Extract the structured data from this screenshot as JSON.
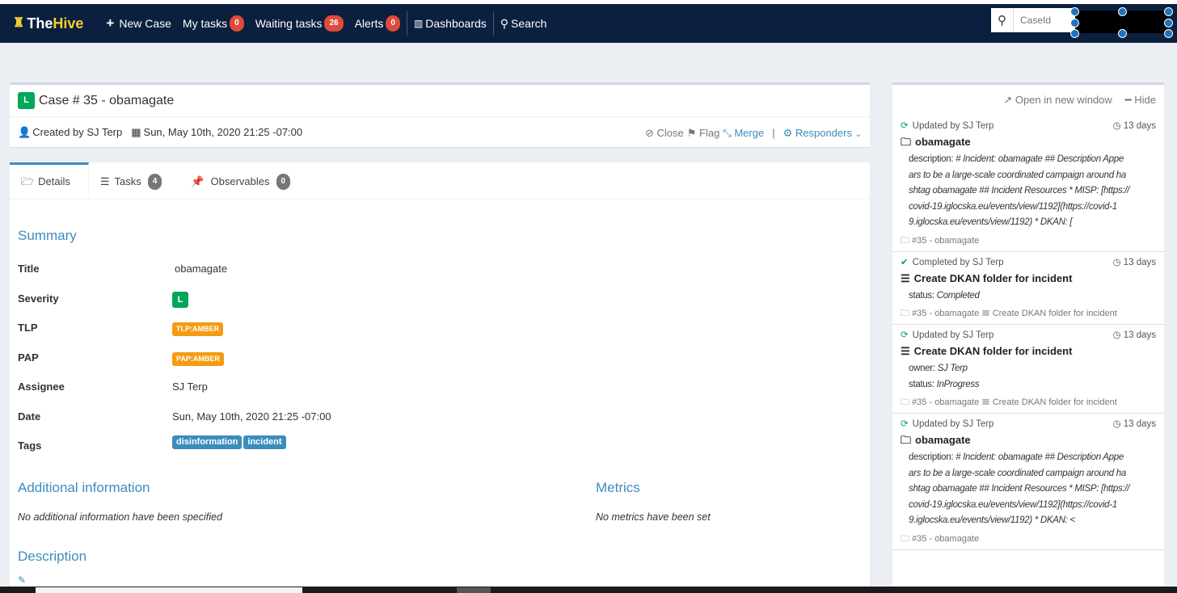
{
  "nav": {
    "logo_the": "The",
    "logo_hive": "Hive",
    "new_case": "New Case",
    "my_tasks": "My tasks",
    "my_tasks_count": "0",
    "waiting_tasks": "Waiting tasks",
    "waiting_tasks_count": "26",
    "alerts": "Alerts",
    "alerts_count": "0",
    "dashboards": "Dashboards",
    "search": "Search",
    "caseid_placeholder": "CaseId"
  },
  "case": {
    "severity": "L",
    "title": "Case # 35 - obamagate",
    "created_by": "Created by SJ Terp",
    "date": "Sun, May 10th, 2020 21:25 -07:00",
    "actions": {
      "close": "Close",
      "flag": "Flag",
      "merge": "Merge",
      "sep": "|",
      "responders": "Responders"
    }
  },
  "tabs": [
    {
      "label": "Details",
      "icon": "folder-open-icon"
    },
    {
      "label": "Tasks",
      "count": "4",
      "icon": "tasks-icon"
    },
    {
      "label": "Observables",
      "count": "0",
      "icon": "pin-icon"
    }
  ],
  "summary": {
    "heading": "Summary",
    "fields": [
      {
        "label": "Title",
        "value": "obamagate"
      },
      {
        "label": "Severity",
        "value": "L"
      },
      {
        "label": "TLP",
        "value": "TLP:AMBER"
      },
      {
        "label": "PAP",
        "value": "PAP:AMBER"
      },
      {
        "label": "Assignee",
        "value": "SJ Terp"
      },
      {
        "label": "Date",
        "value": "Sun, May 10th, 2020 21:25 -07:00"
      },
      {
        "label": "Tags",
        "value": ""
      }
    ],
    "tags": [
      "disinformation",
      "incident"
    ]
  },
  "additional": {
    "heading": "Additional information",
    "empty": "No additional information have been specified"
  },
  "metrics": {
    "heading": "Metrics",
    "empty": "No metrics have been set"
  },
  "description": {
    "heading": "Description"
  },
  "colors": {
    "nav": "#0b1f3f",
    "accent": "#3c8dbc",
    "severity_low": "#00a65a",
    "amber": "#f39c12",
    "badge_red": "#dd4b39"
  },
  "side": {
    "open_new": "Open in new window",
    "hide": "Hide",
    "events": [
      {
        "action": "Updated by SJ Terp",
        "icon": "refresh-icon",
        "time": "13 days",
        "title": "obamagate",
        "title_icon": "folder-icon",
        "body": [
          {
            "k": "description: ",
            "v": "# Incident: obamagate ## Description Appe"
          },
          {
            "k": "",
            "v": "ars to be a large-scale coordinated campaign around ha"
          },
          {
            "k": "",
            "v": "shtag obamagate ## Incident Resources * MISP: [https://"
          },
          {
            "k": "",
            "v": "covid-19.iglocska.eu/events/view/1192](https://covid-1"
          },
          {
            "k": "",
            "v": "9.iglocska.eu/events/view/1192) * DKAN: ["
          }
        ],
        "footer_case": "#35 - obamagate",
        "footer_task": ""
      },
      {
        "action": "Completed by SJ Terp",
        "icon": "check-icon",
        "time": "13 days",
        "title": "Create DKAN folder for incident",
        "title_icon": "tasks-icon",
        "body": [
          {
            "k": "status: ",
            "v": "Completed"
          }
        ],
        "footer_case": "#35 - obamagate",
        "footer_task": "Create DKAN folder for incident"
      },
      {
        "action": "Updated by SJ Terp",
        "icon": "refresh-icon",
        "time": "13 days",
        "title": "Create DKAN folder for incident",
        "title_icon": "tasks-icon",
        "body": [
          {
            "k": "owner: ",
            "v": "SJ Terp"
          },
          {
            "k": "status: ",
            "v": "InProgress"
          }
        ],
        "footer_case": "#35 - obamagate",
        "footer_task": "Create DKAN folder for incident"
      },
      {
        "action": "Updated by SJ Terp",
        "icon": "refresh-icon",
        "time": "13 days",
        "title": "obamagate",
        "title_icon": "folder-icon",
        "body": [
          {
            "k": "description: ",
            "v": "# Incident: obamagate ## Description Appe"
          },
          {
            "k": "",
            "v": "ars to be a large-scale coordinated campaign around ha"
          },
          {
            "k": "",
            "v": "shtag obamagate ## Incident Resources * MISP: [https://"
          },
          {
            "k": "",
            "v": "covid-19.iglocska.eu/events/view/1192](https://covid-1"
          },
          {
            "k": "",
            "v": "9.iglocska.eu/events/view/1192) * DKAN: <"
          }
        ],
        "footer_case": "#35 - obamagate",
        "footer_task": ""
      }
    ]
  }
}
